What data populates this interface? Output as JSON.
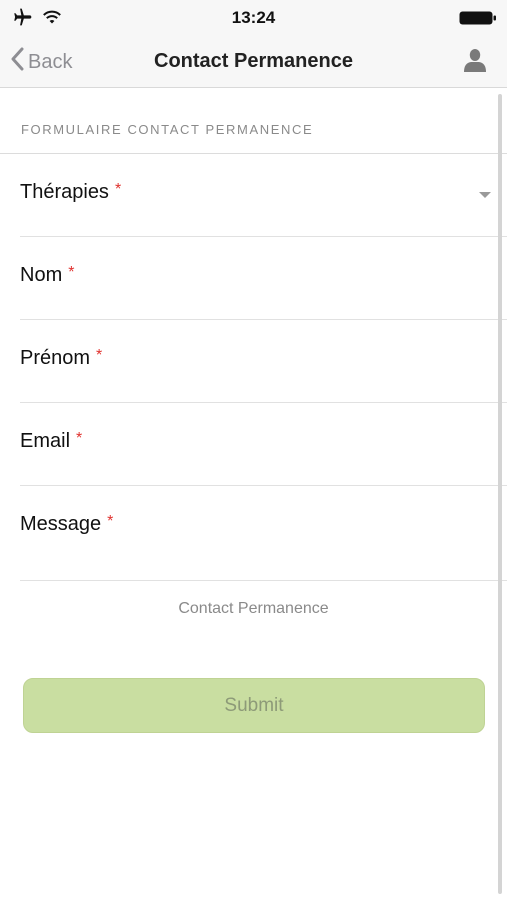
{
  "status_bar": {
    "time": "13:24",
    "icons": [
      "airplane-icon",
      "wifi-icon",
      "battery-icon"
    ]
  },
  "nav": {
    "back_label": "Back",
    "title": "Contact Permanence",
    "right_icon": "user-icon"
  },
  "form": {
    "section_title": "FORMULAIRE CONTACT PERMANENCE",
    "required_marker": "*",
    "fields": [
      {
        "label": "Thérapies",
        "type": "select"
      },
      {
        "label": "Nom",
        "type": "text"
      },
      {
        "label": "Prénom",
        "type": "text"
      },
      {
        "label": "Email",
        "type": "email"
      },
      {
        "label": "Message",
        "type": "textarea"
      }
    ],
    "caption": "Contact Permanence",
    "submit_label": "Submit"
  },
  "colors": {
    "accent_submit": "#c9dea1",
    "required": "#e0312e"
  }
}
